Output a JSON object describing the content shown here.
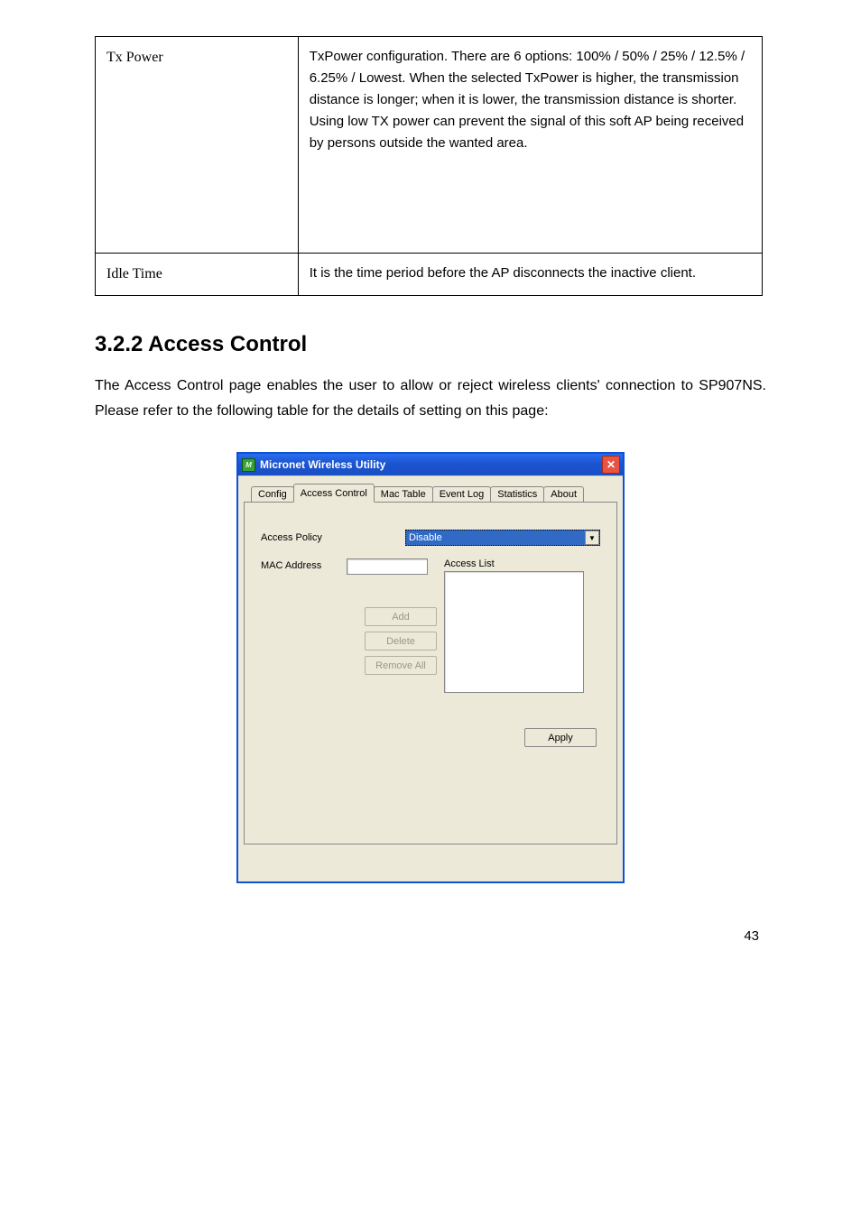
{
  "table": {
    "r1c1": "Tx Power",
    "r1c2": "TxPower configuration. There are 6 options: 100% / 50% / 25% / 12.5% / 6.25% / Lowest. When the selected TxPower is higher, the transmission distance is longer; when it is lower, the transmission distance is shorter. Using low TX power can prevent the signal of this soft AP being received by persons outside the wanted area.",
    "r2c1": "Idle Time",
    "r2c2": "It is the time period before the AP disconnects the inactive client."
  },
  "section_heading": "3.2.2 Access Control",
  "body_text": "The Access Control page enables the user to allow or reject wireless clients' connection to SP907NS. Please refer to the following table for the details of setting on this page:",
  "dialog": {
    "title": "Micronet Wireless Utility",
    "icon_text": "M",
    "tabs": [
      "Config",
      "Access Control",
      "Mac Table",
      "Event Log",
      "Statistics",
      "About"
    ],
    "active_tab_index": 1,
    "access_policy_label": "Access Policy",
    "access_policy_value": "Disable",
    "mac_address_label": "MAC Address",
    "access_list_label": "Access List",
    "btn_add": "Add",
    "btn_delete": "Delete",
    "btn_remove_all": "Remove All",
    "btn_apply": "Apply"
  },
  "page_number": "43"
}
